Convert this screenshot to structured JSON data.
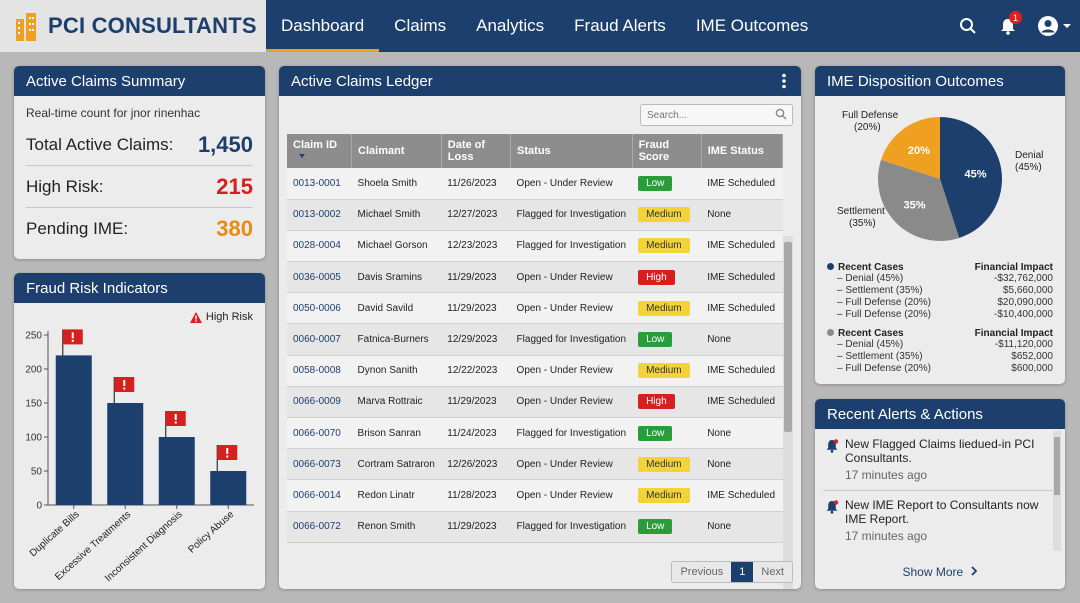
{
  "brand": {
    "name": "PCI CONSULTANTS"
  },
  "nav": {
    "tabs": [
      "Dashboard",
      "Claims",
      "Analytics",
      "Fraud Alerts",
      "IME Outcomes"
    ],
    "active": "Dashboard",
    "notification_count": "1"
  },
  "summary": {
    "title": "Active Claims Summary",
    "subtitle": "Real-time count for jnor rinenhac",
    "rows": [
      {
        "label": "Total Active Claims:",
        "value": "1,450",
        "color": "#1d3f6e"
      },
      {
        "label": "High Risk:",
        "value": "215",
        "color": "#d62020"
      },
      {
        "label": "Pending IME:",
        "value": "380",
        "color": "#e88a1a"
      }
    ]
  },
  "fraud_chart": {
    "title": "Fraud Risk Indicators",
    "legend": "High Risk",
    "chart_data": {
      "type": "bar",
      "categories": [
        "Duplicate Bills",
        "Excessive Treatments",
        "Inconsistent Diagnosis",
        "Policy Abuse"
      ],
      "values": [
        220,
        150,
        100,
        50
      ],
      "ylim": [
        0,
        250
      ],
      "yticks": [
        "0",
        "50",
        "100",
        "150",
        "200",
        "250"
      ],
      "bar_color": "#1d3f6e",
      "flag_color": "#d62020"
    }
  },
  "ledger": {
    "title": "Active Claims Ledger",
    "search_placeholder": "Search...",
    "columns": [
      "Claim ID",
      "Claimant",
      "Date of Loss",
      "Status",
      "Fraud Score",
      "IME Status"
    ],
    "rows": [
      {
        "id": "0013-0001",
        "claimant": "Shoela Smith",
        "date": "11/26/2023",
        "status": "Open - Under Review",
        "score": "Low",
        "ime": "IME Scheduled"
      },
      {
        "id": "0013-0002",
        "claimant": "Michael Smith",
        "date": "12/27/2023",
        "status": "Flagged for Investigation",
        "score": "Medium",
        "ime": "None"
      },
      {
        "id": "0028-0004",
        "claimant": "Michael Gorson",
        "date": "12/23/2023",
        "status": "Flagged for Investigation",
        "score": "Medium",
        "ime": "IME Scheduled"
      },
      {
        "id": "0036-0005",
        "claimant": "Davis Sramins",
        "date": "11/29/2023",
        "status": "Open - Under Review",
        "score": "High",
        "ime": "IME Scheduled"
      },
      {
        "id": "0050-0006",
        "claimant": "David Savild",
        "date": "11/29/2023",
        "status": "Open - Under Review",
        "score": "Medium",
        "ime": "IME Scheduled"
      },
      {
        "id": "0060-0007",
        "claimant": "Fatnica-Burners",
        "date": "12/29/2023",
        "status": "Flagged for Investigation",
        "score": "Low",
        "ime": "None"
      },
      {
        "id": "0058-0008",
        "claimant": "Dynon Sanith",
        "date": "12/22/2023",
        "status": "Open - Under Review",
        "score": "Medium",
        "ime": "IME Scheduled"
      },
      {
        "id": "0066-0009",
        "claimant": "Marva Rottraic",
        "date": "11/29/2023",
        "status": "Open - Under Review",
        "score": "High",
        "ime": "IME Scheduled"
      },
      {
        "id": "0066-0070",
        "claimant": "Brison Sanran",
        "date": "11/24/2023",
        "status": "Flagged for Investigation",
        "score": "Low",
        "ime": "None"
      },
      {
        "id": "0066-0073",
        "claimant": "Cortram Satraron",
        "date": "12/26/2023",
        "status": "Open - Under Review",
        "score": "Medium",
        "ime": "None"
      },
      {
        "id": "0066-0014",
        "claimant": "Redon Linatr",
        "date": "11/28/2023",
        "status": "Open - Under Review",
        "score": "Medium",
        "ime": "IME Scheduled"
      },
      {
        "id": "0066-0072",
        "claimant": "Renon Smith",
        "date": "11/29/2023",
        "status": "Flagged for Investigation",
        "score": "Low",
        "ime": "None"
      }
    ],
    "pager": {
      "prev": "Previous",
      "current": "1",
      "next": "Next"
    }
  },
  "ime": {
    "title": "IME Disposition Outcomes",
    "chart_data": {
      "type": "pie",
      "slices": [
        {
          "label": "Denial",
          "pct_label": "(45%)",
          "inner": "45%",
          "value": 45,
          "color": "#1d3f6e"
        },
        {
          "label": "Settlement",
          "pct_label": "(35%)",
          "inner": "35%",
          "value": 35,
          "color": "#8a8a8a"
        },
        {
          "label": "Full Defense",
          "pct_label": "(20%)",
          "inner": "20%",
          "value": 20,
          "color": "#f0a020"
        }
      ]
    },
    "sections": [
      {
        "head": "Recent Cases",
        "impact_head": "Financial Impact",
        "dot": "#1d3f6e",
        "lines": [
          {
            "label": "Denial (45%)",
            "value": "-$32,762,000"
          },
          {
            "label": "Settlement (35%)",
            "value": "$5,660,000"
          },
          {
            "label": "Full Defense (20%)",
            "value": "$20,090,000"
          },
          {
            "label": "Full Defense (20%)",
            "value": "-$10,400,000"
          }
        ]
      },
      {
        "head": "Recent Cases",
        "impact_head": "Financial Impact",
        "dot": "#8a8a8a",
        "lines": [
          {
            "label": "Denial (45%)",
            "value": "-$11,120,000"
          },
          {
            "label": "Settlement (35%)",
            "value": "$652,000"
          },
          {
            "label": "Full Defense (20%)",
            "value": "$600,000"
          }
        ]
      }
    ]
  },
  "alerts": {
    "title": "Recent Alerts & Actions",
    "items": [
      {
        "text": "New Flagged Claims liedued-in PCI Consultants.",
        "time": "17 minutes ago"
      },
      {
        "text": "New IME Report to Consultants now IME Report.",
        "time": "17 minutes ago"
      }
    ],
    "show_more": "Show More"
  }
}
